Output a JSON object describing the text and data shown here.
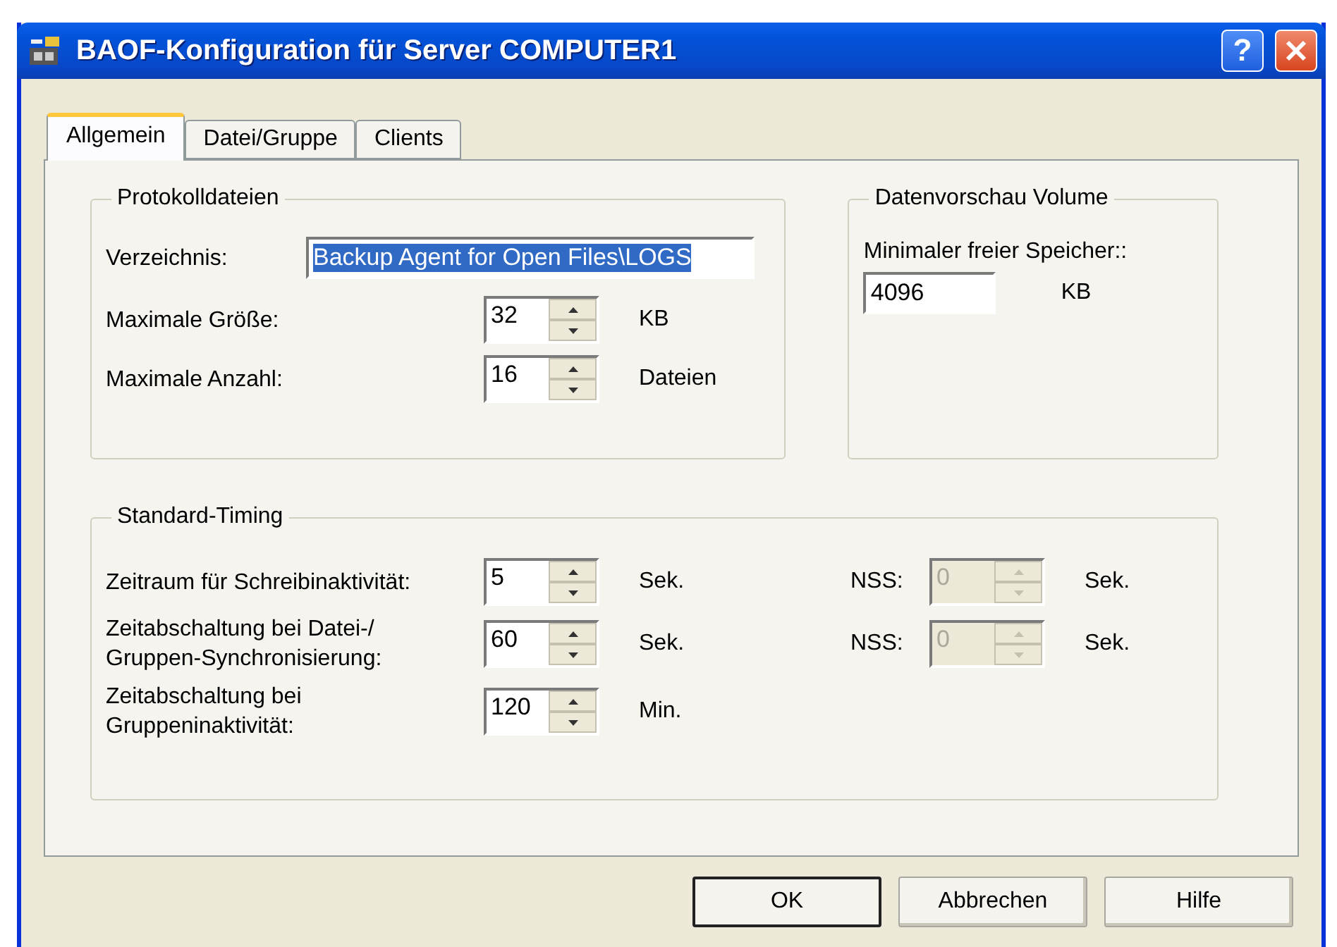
{
  "window": {
    "title": "BAOF-Konfiguration für Server COMPUTER1",
    "help_button": "?"
  },
  "tabs": [
    {
      "label": "Allgemein",
      "selected": true
    },
    {
      "label": "Datei/Gruppe",
      "selected": false
    },
    {
      "label": "Clients",
      "selected": false
    }
  ],
  "log_files": {
    "title": "Protokolldateien",
    "directory": {
      "label": "Verzeichnis:",
      "value": "Backup Agent for Open Files\\LOGS",
      "selected": true
    },
    "rows": [
      {
        "label": "Maximale Größe:",
        "value": "32",
        "unit": "KB"
      },
      {
        "label": "Maximale Anzahl:",
        "value": "16",
        "unit": "Dateien"
      }
    ]
  },
  "preview_volume": {
    "title": "Datenvorschau Volume",
    "label": "Minimaler freier Speicher::",
    "value": "4096",
    "unit": "KB"
  },
  "timing": {
    "title": "Standard-Timing",
    "rows": [
      {
        "label": "Zeitraum für Schreibinaktivität:",
        "value": "5",
        "unit": "Sek.",
        "nss": {
          "label": "NSS:",
          "value": "0",
          "unit": "Sek.",
          "disabled": true
        }
      },
      {
        "label": "Zeitabschaltung bei Datei-/\nGruppen-Synchronisierung:",
        "value": "60",
        "unit": "Sek.",
        "nss": {
          "label": "NSS:",
          "value": "0",
          "unit": "Sek.",
          "disabled": true
        }
      },
      {
        "label": "Zeitabschaltung bei\nGruppeninaktivität:",
        "value": "120",
        "unit": "Min."
      }
    ]
  },
  "buttons": [
    {
      "label": "OK",
      "default": true
    },
    {
      "label": "Abbrechen",
      "default": false
    },
    {
      "label": "Hilfe",
      "default": false
    }
  ]
}
